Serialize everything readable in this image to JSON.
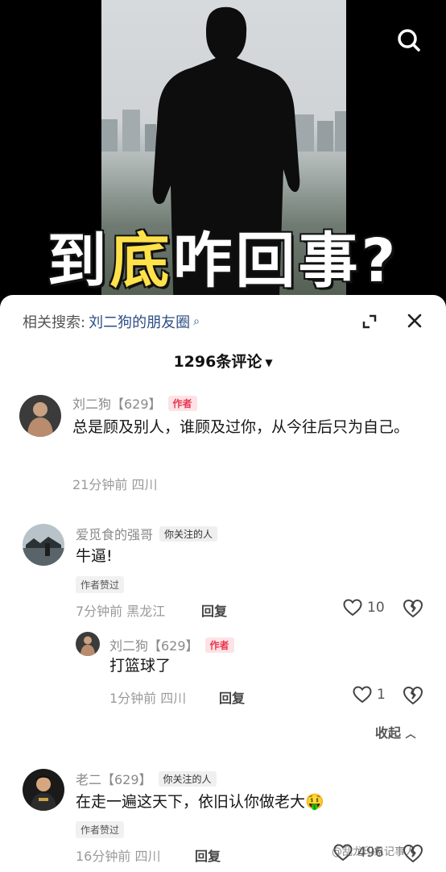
{
  "video": {
    "overlay_title_part1": "到",
    "overlay_title_part2": "底",
    "overlay_title_part3": "咋回事?"
  },
  "related_search": {
    "label": "相关搜索:",
    "keyword": "刘二狗的朋友圈",
    "search_glyph": "⌕"
  },
  "comments_count": "1296条评论",
  "comments": [
    {
      "author": "刘二狗【629】",
      "badge": "作者",
      "text": "总是顾及别人，谁顾及过你，从今往后只为自己。",
      "meta": "21分钟前 四川"
    },
    {
      "author": "爱觅食的强哥",
      "badge": "你关注的人",
      "text": "牛逼!",
      "liked_by_author": "作者赞过",
      "meta": "7分钟前 黑龙江",
      "reply_label": "回复",
      "likes": "10",
      "replies": [
        {
          "author": "刘二狗【629】",
          "badge": "作者",
          "text": "打篮球了",
          "meta": "1分钟前 四川",
          "reply_label": "回复",
          "likes": "1"
        }
      ],
      "collapse_label": "收起"
    },
    {
      "author": "老二【629】",
      "badge": "你关注的人",
      "text": "在走一遍这天下，依旧认你做老大",
      "emoji": "🤑",
      "liked_by_author": "作者赞过",
      "meta": "16分钟前 四川",
      "reply_label": "回复",
      "likes": "496"
    }
  ],
  "watermark": "@乱龙印象记事人",
  "colors": {
    "author_badge": "#e8384f",
    "highlight_title": "#ffe24a",
    "related_keyword": "#2e4d86"
  }
}
